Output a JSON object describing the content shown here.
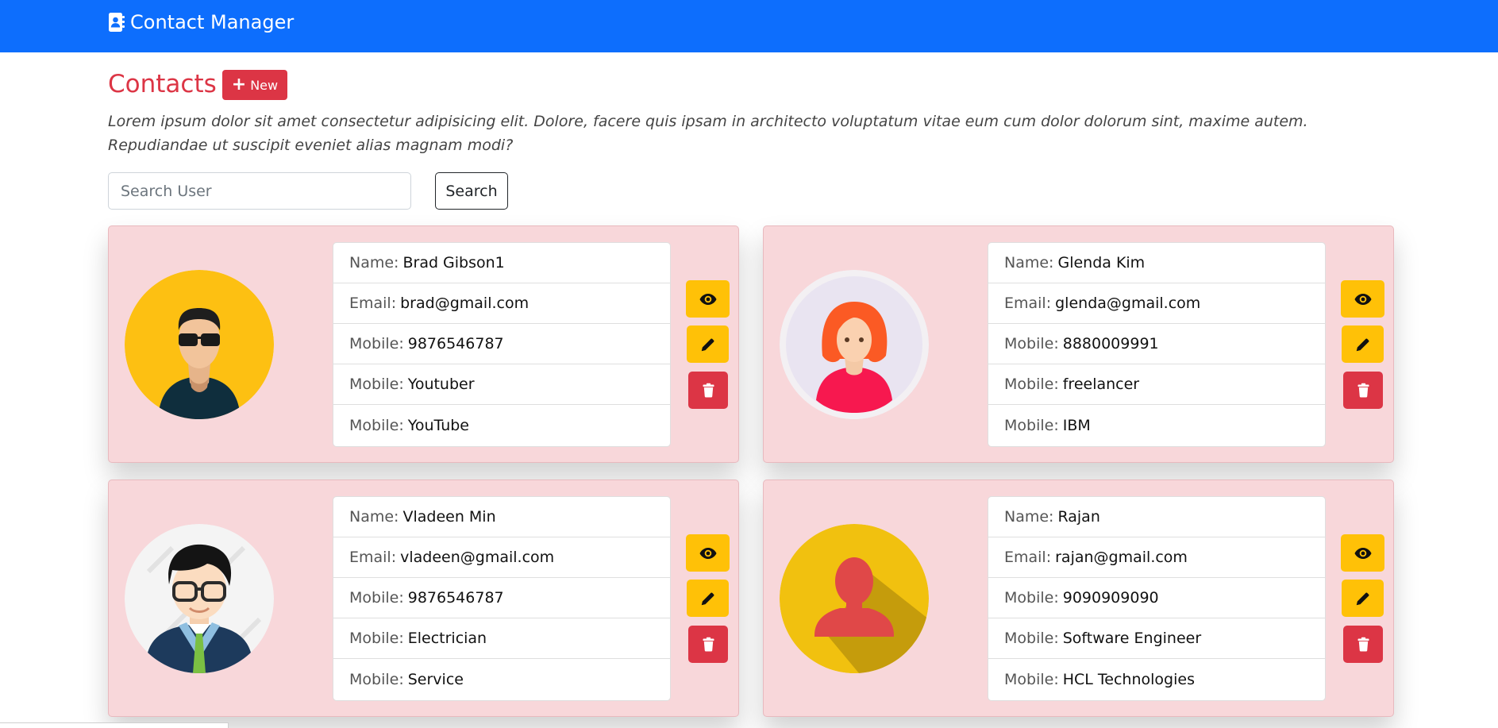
{
  "app": {
    "title": "Contact Manager"
  },
  "page": {
    "heading": "Contacts",
    "new_button_label": "New",
    "intro": "Lorem ipsum dolor sit amet consectetur adipisicing elit. Dolore, facere quis ipsam in architecto voluptatum vitae eum cum dolor dolorum sint, maxime autem. Repudiandae ut suscipit eveniet alias magnam modi?"
  },
  "search": {
    "placeholder": "Search User",
    "value": "",
    "button_label": "Search"
  },
  "colors": {
    "navbar": "#0d6efd",
    "accent_red": "#dc3545",
    "warning_yellow": "#ffc107",
    "card_background": "#f8d7da"
  },
  "icons": {
    "brand": "address-book-icon",
    "new": "plus-icon",
    "view": "eye-icon",
    "edit": "pencil-icon",
    "delete": "trash-icon"
  },
  "contacts": [
    {
      "avatar": "man-sunglasses-avatar",
      "fields": [
        {
          "label": "Name:",
          "value": "Brad Gibson1"
        },
        {
          "label": "Email:",
          "value": "brad@gmail.com"
        },
        {
          "label": "Mobile:",
          "value": "9876546787"
        },
        {
          "label": "Mobile:",
          "value": "Youtuber"
        },
        {
          "label": "Mobile:",
          "value": "YouTube"
        }
      ]
    },
    {
      "avatar": "woman-red-hair-avatar",
      "fields": [
        {
          "label": "Name:",
          "value": "Glenda Kim"
        },
        {
          "label": "Email:",
          "value": "glenda@gmail.com"
        },
        {
          "label": "Mobile:",
          "value": "8880009991"
        },
        {
          "label": "Mobile:",
          "value": "freelancer"
        },
        {
          "label": "Mobile:",
          "value": "IBM"
        }
      ]
    },
    {
      "avatar": "man-glasses-suit-avatar",
      "fields": [
        {
          "label": "Name:",
          "value": "Vladeen Min"
        },
        {
          "label": "Email:",
          "value": "vladeen@gmail.com"
        },
        {
          "label": "Mobile:",
          "value": "9876546787"
        },
        {
          "label": "Mobile:",
          "value": "Electrician"
        },
        {
          "label": "Mobile:",
          "value": "Service"
        }
      ]
    },
    {
      "avatar": "user-silhouette-avatar",
      "fields": [
        {
          "label": "Name:",
          "value": "Rajan"
        },
        {
          "label": "Email:",
          "value": "rajan@gmail.com"
        },
        {
          "label": "Mobile:",
          "value": "9090909090"
        },
        {
          "label": "Mobile:",
          "value": "Software Engineer"
        },
        {
          "label": "Mobile:",
          "value": "HCL Technologies"
        }
      ]
    }
  ]
}
